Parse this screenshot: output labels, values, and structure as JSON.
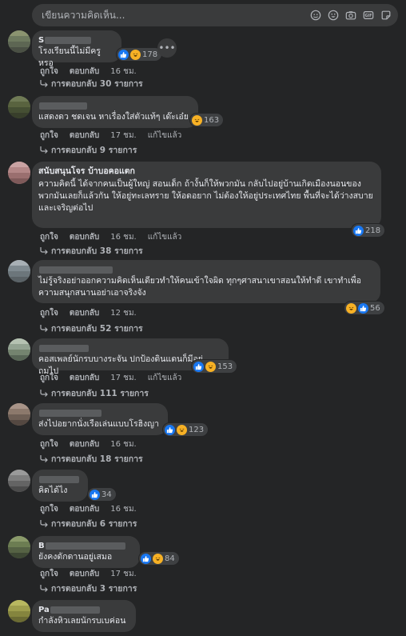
{
  "composer": {
    "placeholder": "เขียนความคิดเห็น..."
  },
  "labels": {
    "like": "ถูกใจ",
    "reply": "ตอบกลับ",
    "edited": "แก้ไขแล้ว"
  },
  "comments": [
    {
      "author_visible": "S",
      "text": "โรงเรียนนี้ไม่มีครูหรอ",
      "reactions": "178",
      "time": "16 ชม.",
      "edited": false,
      "replies": "การตอบกลับ 30 รายการ"
    },
    {
      "author_visible": "",
      "text": "แสดงดว ชดเจน หาเรื่องใส่ตัวแท้ๆ เด๊ะเอ๋ย",
      "reactions": "163",
      "time": "17 ชม.",
      "edited": true,
      "replies": "การตอบกลับ 9 รายการ"
    },
    {
      "author_visible": "สนับสนุนโจร บ้าบอคอแตก",
      "text": "ความคิดนี้ ได้จากคนเป็นผู้ใหญ่ สอนเด็ก ถ้างั้นก็ให้พวกมัน กลับไปอยู่บ้านเกิดเมืองนอนของพวกมันเลยก็แล้วกัน ให้อยู่ทะเลทราย ให้อดอยาก ไม่ต้องให้อยู่ประเทศไทย พื้นที่จะได้ว่างสบายและเจริญต่อไป",
      "reactions": "218",
      "time": "16 ชม.",
      "edited": true,
      "replies": "การตอบกลับ 38 รายการ"
    },
    {
      "author_visible": "",
      "text": "ไม่รู้จริงอย่าออกความคิดเห็นเดียวทำให้คนเข้าใจผิด ทุกๆศาสนาเขาสอนให้ทำดี เขาทำเพื่อความสนุกสนานอย่าเอาจริงจัง",
      "reactions": "56",
      "time": "12 ชม.",
      "edited": false,
      "replies": "การตอบกลับ 52 รายการ"
    },
    {
      "author_visible": "",
      "text": "คอสเพลย์นักรบบางระจัน ปกป้องดินแดนก็มีอยู่ถมไป",
      "reactions": "153",
      "time": "17 ชม.",
      "edited": true,
      "replies": "การตอบกลับ 111 รายการ"
    },
    {
      "author_visible": "",
      "text": "ส่งไปอยากนั่งเรือเล่นแบบโรฮิงญา",
      "reactions": "123",
      "time": "16 ชม.",
      "edited": false,
      "replies": "การตอบกลับ 18 รายการ"
    },
    {
      "author_visible": "",
      "text": "คิดได้ไง",
      "reactions": "34",
      "time": "16 ชม.",
      "edited": false,
      "replies": "การตอบกลับ 6 รายการ"
    },
    {
      "author_visible": "B",
      "text": "ยังคงดักดานอยู่เสมอ",
      "reactions": "84",
      "time": "17 ชม.",
      "edited": false,
      "replies": "การตอบกลับ 3 รายการ"
    },
    {
      "author_visible": "Pa",
      "text": "กำลังหิวเลยนักรบเบค่อน",
      "reactions": "",
      "time": "",
      "edited": false,
      "replies": ""
    }
  ],
  "colors": {
    "background": "#242526",
    "bubble": "#3a3b3c",
    "like": "#1877f2",
    "haha": "#f7b125",
    "muted": "#b0b3b8"
  }
}
